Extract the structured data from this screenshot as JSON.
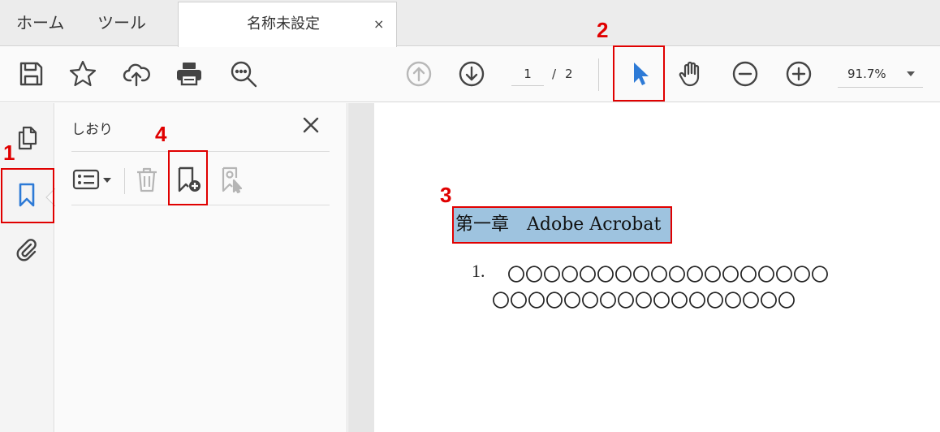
{
  "tabs": {
    "home": "ホーム",
    "tools": "ツール",
    "document": "名称未設定",
    "close_glyph": "×"
  },
  "toolbar": {
    "page_current": "1",
    "page_separator": "/",
    "page_total": "2",
    "zoom": "91.7%"
  },
  "panel": {
    "title": "しおり"
  },
  "document": {
    "heading": "第一章　Adobe Acrobat",
    "list_number": "1.",
    "list_line1": "〇〇〇〇〇〇〇〇〇〇〇〇〇〇〇〇〇〇",
    "list_line2": "〇〇〇〇〇〇〇〇〇〇〇〇〇〇〇〇〇"
  },
  "annotations": {
    "one": "1",
    "two": "2",
    "three": "3",
    "four": "4"
  },
  "colors": {
    "accent_blue": "#2d7ad6",
    "annotation_red": "#e00000",
    "selection_blue": "#9ec3df"
  },
  "icons": [
    "save-icon",
    "star-icon",
    "cloud-upload-icon",
    "print-icon",
    "zoom-search-icon",
    "arrow-up-icon",
    "arrow-down-icon",
    "select-cursor-icon",
    "hand-icon",
    "zoom-out-icon",
    "zoom-in-icon",
    "pages-icon",
    "bookmark-icon",
    "attachment-icon",
    "options-icon",
    "trash-icon",
    "new-bookmark-icon",
    "bookmark-from-selection-icon",
    "close-icon"
  ]
}
